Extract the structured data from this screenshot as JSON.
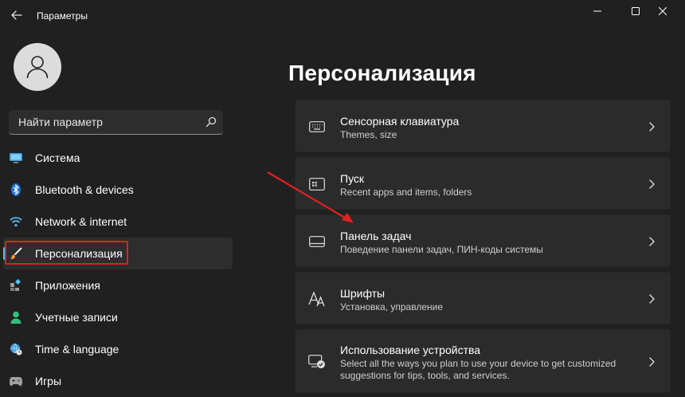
{
  "window": {
    "title": "Параметры",
    "controls": [
      "minimize",
      "maximize",
      "close"
    ]
  },
  "sidebar": {
    "search": {
      "value": "",
      "placeholder": "Найти параметр"
    },
    "items": [
      {
        "label": "Система",
        "icon": "monitor-icon",
        "selected": false
      },
      {
        "label": "Bluetooth & devices",
        "icon": "bluetooth-icon",
        "selected": false
      },
      {
        "label": "Network & internet",
        "icon": "wifi-icon",
        "selected": false
      },
      {
        "label": "Персонализация",
        "icon": "brush-icon",
        "selected": true
      },
      {
        "label": "Приложения",
        "icon": "apps-icon",
        "selected": false
      },
      {
        "label": "Учетные записи",
        "icon": "person-icon",
        "selected": false
      },
      {
        "label": "Time & language",
        "icon": "globe-clock-icon",
        "selected": false
      },
      {
        "label": "Игры",
        "icon": "gamepad-icon",
        "selected": false
      }
    ]
  },
  "main": {
    "title": "Персонализация",
    "cards": [
      {
        "title": "Сенсорная клавиатура",
        "subtitle": "Themes, size",
        "icon": "keyboard-icon"
      },
      {
        "title": "Пуск",
        "subtitle": "Recent apps and items, folders",
        "icon": "start-menu-icon"
      },
      {
        "title": "Панель задач",
        "subtitle": "Поведение панели задач, ПИН-коды системы",
        "icon": "taskbar-icon"
      },
      {
        "title": "Шрифты",
        "subtitle": "Установка, управление",
        "icon": "fonts-icon"
      },
      {
        "title": "Использование устройства",
        "subtitle": "Select all the ways you plan to use your device to get customized suggestions for tips, tools, and services.",
        "icon": "device-usage-icon"
      }
    ]
  },
  "colors": {
    "background": "#202020",
    "card": "#2b2b2b",
    "accent": "#4cc2ff",
    "annotation": "#e02020"
  }
}
